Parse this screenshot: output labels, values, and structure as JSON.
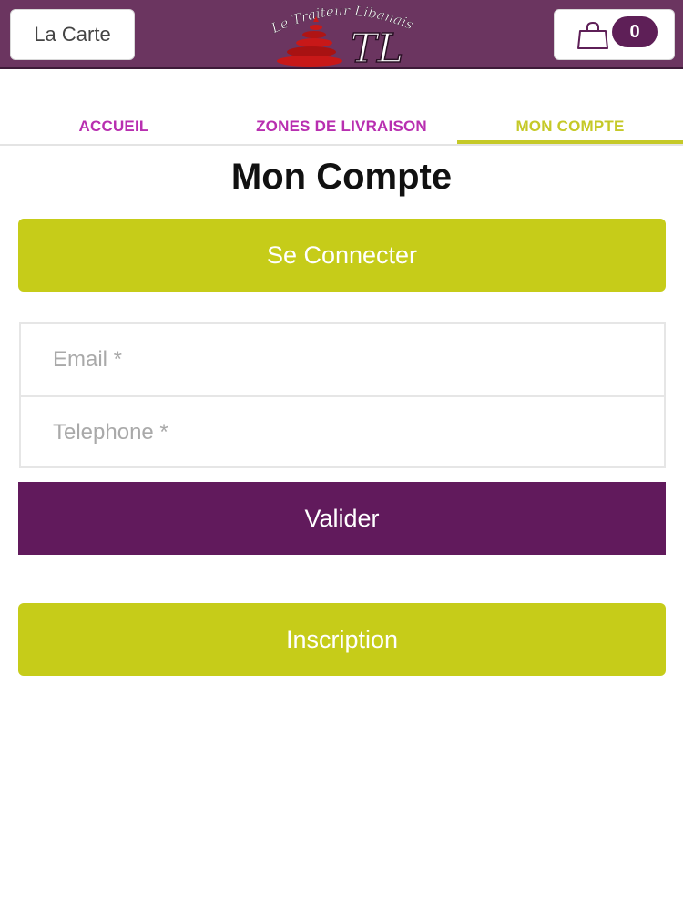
{
  "header": {
    "menu_label": "La Carte",
    "logo_text": "Le Traiteur Libanais",
    "logo_monogram": "TL",
    "cart_icon": "shopping-bag-icon",
    "cart_count": "0"
  },
  "nav": {
    "tabs": [
      {
        "label": "ACCUEIL"
      },
      {
        "label": "ZONES DE LIVRAISON"
      },
      {
        "label": "MON COMPTE",
        "active": true
      }
    ]
  },
  "page": {
    "title": "Mon Compte"
  },
  "buttons": {
    "connect": "Se Connecter",
    "validate": "Valider",
    "inscription": "Inscription"
  },
  "form": {
    "email_placeholder": "Email *",
    "email_value": "",
    "phone_placeholder": "Telephone *",
    "phone_value": ""
  },
  "colors": {
    "header_bg": "#6b3560",
    "brand_purple": "#611a5c",
    "accent_lime": "#c6cc19",
    "tab_magenta": "#b82fb0",
    "logo_red": "#c81818"
  }
}
